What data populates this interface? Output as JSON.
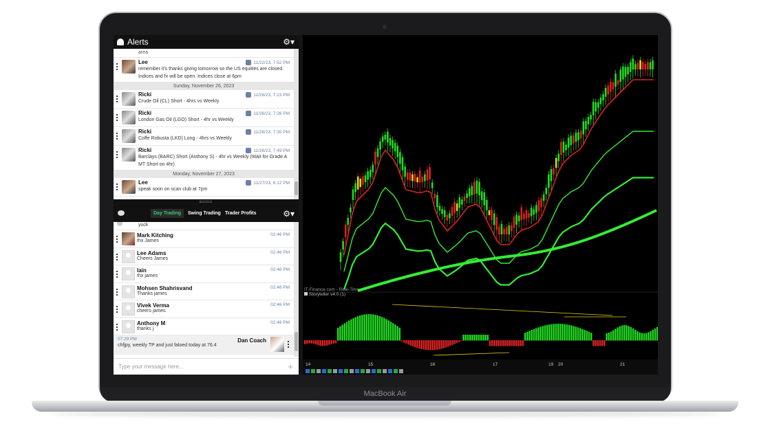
{
  "device": {
    "label": "MacBook Air"
  },
  "alerts": {
    "title": "Alerts",
    "top_fragment": "area",
    "items": [
      {
        "type": "msg",
        "name": "Lee",
        "avatar": "lee",
        "time": "11/22/23, 7:52 PM",
        "text": "remember it's thanks giving tomorrow so the US equities are closed. Indices and fx will be open. Indices close at 6pm"
      },
      {
        "type": "sep",
        "text": "Sunday, November 26, 2023"
      },
      {
        "type": "msg",
        "name": "Ricki",
        "avatar": "ricki",
        "time": "11/26/23, 7:23 PM",
        "text": "Crude Oil (CL) Short - 4hrs vs Weekly"
      },
      {
        "type": "msg",
        "name": "Ricki",
        "avatar": "ricki",
        "time": "11/26/23, 7:26 PM",
        "text": "London Gas Oil (LGO) Short - 4hr vs Weekly"
      },
      {
        "type": "msg",
        "name": "Ricki",
        "avatar": "ricki",
        "time": "11/26/23, 7:35 PM",
        "text": "Coffe Robusta (LKD) Long - 4hrs vs Weekly"
      },
      {
        "type": "msg",
        "name": "Ricki",
        "avatar": "ricki",
        "time": "11/26/23, 7:49 PM",
        "text": "Barclays (BARC) Short (Anthony S) - 4hr vs Weekly (Wait for Grade A MT Short on 4hr)"
      },
      {
        "type": "sep",
        "text": "Monday, November 27, 2023"
      },
      {
        "type": "msg",
        "name": "Lee",
        "avatar": "lee",
        "time": "11/27/23, 6:12 PM",
        "text": "speak soon on scan club at 7pm"
      }
    ]
  },
  "chat": {
    "tabs": [
      {
        "label": "Day Trading",
        "active": true
      },
      {
        "label": "Swing Trading",
        "active": false
      },
      {
        "label": "Trader Profits",
        "active": false
      }
    ],
    "top_fragment": "yuck",
    "messages": [
      {
        "name": "Mark Kitching",
        "time": "02:46 PM",
        "text": "thx James",
        "avatar": "photo"
      },
      {
        "name": "Lee Adams",
        "time": "02:46 PM",
        "text": "Cheers James",
        "avatar": "default"
      },
      {
        "name": "Iain",
        "time": "02:46 PM",
        "text": "thx james",
        "avatar": "default"
      },
      {
        "name": "Mohsen Shahrisvand",
        "time": "02:46 PM",
        "text": "Thanks james",
        "avatar": "default"
      },
      {
        "name": "Vivek Verma",
        "time": "02:46 PM",
        "text": "cheers james",
        "avatar": "default"
      },
      {
        "name": "Anthony M",
        "time": "02:48 PM",
        "text": "thanks j",
        "avatar": "default"
      }
    ],
    "own_message": {
      "time": "07:29 PM",
      "name": "Dan Coach",
      "text": "chfjpy, weekly TP and just faloed today at 76.4"
    },
    "input_placeholder": "Type your message here..."
  },
  "chart": {
    "source_label": "IT-Finance.com - Real-Time",
    "indicator_label": "Storyteller v4.0 (1)",
    "x_tick_labels": [
      "14",
      "15",
      "16",
      "17",
      "19",
      "20",
      "21"
    ],
    "colors": {
      "up": "#22dd22",
      "down": "#dd2222",
      "ma": "#33ee33",
      "yellow": "#e8d21a",
      "bg": "#000000"
    }
  }
}
